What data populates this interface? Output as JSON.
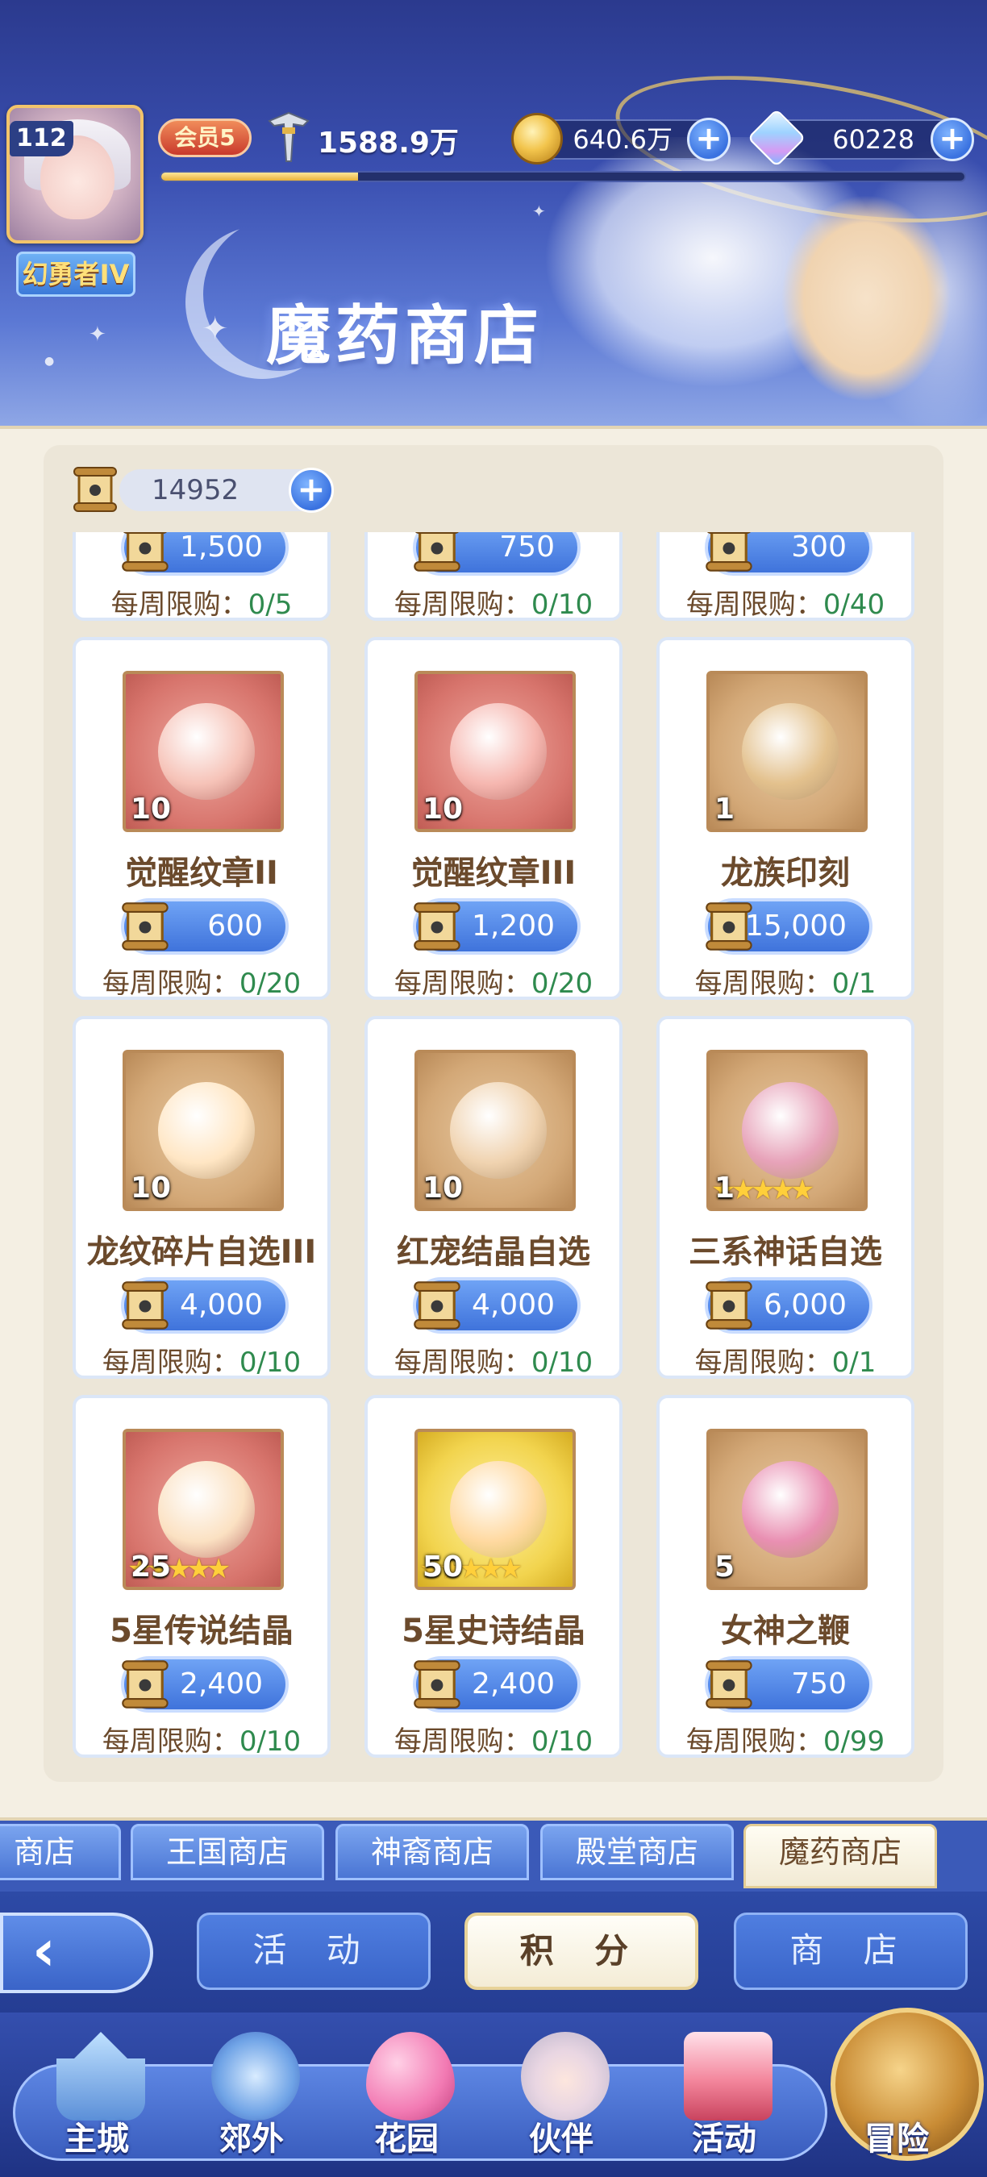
{
  "header": {
    "title": "魔药商店",
    "player": {
      "level": "112",
      "rank_title": "幻勇者IV",
      "vip_label": "会员5",
      "power": "1588.9万",
      "exp_progress": 0.245
    },
    "resources": {
      "gold": "640.6万",
      "diamonds": "60228",
      "plus": "+"
    }
  },
  "shop": {
    "currency": {
      "amount": "14952",
      "plus": "+"
    },
    "items": [
      {
        "name": "",
        "qty": "",
        "price": "1,500",
        "limit_label": "每周限购：",
        "limit": "0/5"
      },
      {
        "name": "",
        "qty": "",
        "price": "750",
        "limit_label": "每周限购：",
        "limit": "0/10"
      },
      {
        "name": "",
        "qty": "",
        "price": "300",
        "limit_label": "每周限购：",
        "limit": "0/40"
      },
      {
        "name": "觉醒纹章II",
        "qty": "10",
        "price": "600",
        "limit_label": "每周限购：",
        "limit": "0/20"
      },
      {
        "name": "觉醒纹章III",
        "qty": "10",
        "price": "1,200",
        "limit_label": "每周限购：",
        "limit": "0/20"
      },
      {
        "name": "龙族印刻",
        "qty": "1",
        "price": "15,000",
        "limit_label": "每周限购：",
        "limit": "0/1"
      },
      {
        "name": "龙纹碎片自选III",
        "qty": "10",
        "price": "4,000",
        "limit_label": "每周限购：",
        "limit": "0/10"
      },
      {
        "name": "红宠结晶自选",
        "qty": "10",
        "price": "4,000",
        "limit_label": "每周限购：",
        "limit": "0/10"
      },
      {
        "name": "三系神话自选",
        "qty": "1",
        "price": "6,000",
        "limit_label": "每周限购：",
        "limit": "0/1"
      },
      {
        "name": "5星传说结晶",
        "qty": "25",
        "price": "2,400",
        "limit_label": "每周限购：",
        "limit": "0/10"
      },
      {
        "name": "5星史诗结晶",
        "qty": "50",
        "price": "2,400",
        "limit_label": "每周限购：",
        "limit": "0/10"
      },
      {
        "name": "女神之鞭",
        "qty": "5",
        "price": "750",
        "limit_label": "每周限购：",
        "limit": "0/99"
      }
    ]
  },
  "shop_tabs": [
    "商店",
    "王国商店",
    "神裔商店",
    "殿堂商店",
    "魔药商店"
  ],
  "sub_nav": {
    "back": "‹",
    "items": [
      "活 动",
      "积 分",
      "商 店"
    ]
  },
  "bottom_nav": [
    "主城",
    "郊外",
    "花园",
    "伙伴",
    "活动",
    "冒险"
  ],
  "stars": "★★★★★",
  "colors": {
    "accent": "#3f73db",
    "limit_count": "#2f8a4e",
    "text_brown": "#6b4a2c"
  }
}
